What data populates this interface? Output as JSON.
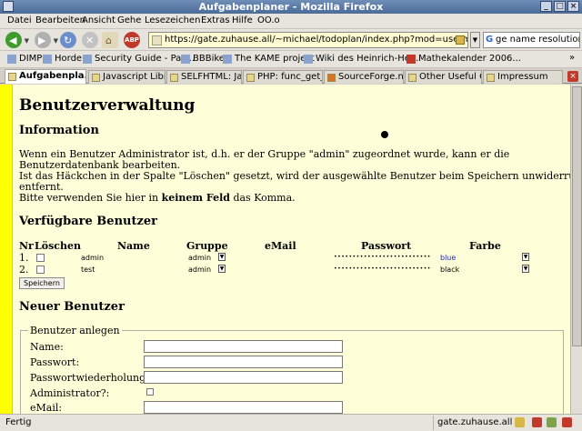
{
  "window": {
    "title": "Aufgabenplaner - Mozilla Firefox"
  },
  "menu": [
    "Datei",
    "Bearbeiten",
    "Ansicht",
    "Gehe",
    "Lesezeichen",
    "Extras",
    "Hilfe",
    "OO.o"
  ],
  "nav": {
    "url": "https://gate.zuhause.all/~michael/todoplan/index.php?mod=usermng",
    "search": "ge name resolution",
    "abp_label": "ABP"
  },
  "bookmarks": [
    "DIMP",
    "Horde",
    "Security Guide - Pas...",
    "BBBike",
    "The KAME project",
    "Wiki des Heinrich-He...",
    "Mathekalender 2006..."
  ],
  "tabs": [
    "Aufgabenpla...",
    "Javascript Libra...",
    "SELFHTML: Jav...",
    "PHP: func_get_...",
    "SourceForge.n...",
    "Other Useful C...",
    "Impressum"
  ],
  "page": {
    "title": "Benutzerverwaltung",
    "info_heading": "Information",
    "info_lines": [
      "Wenn ein Benutzer Administrator ist, d.h. er der Gruppe \"admin\" zugeordnet wurde, kann er die",
      "Benutzerdatenbank bearbeiten.",
      "Ist das Häckchen in der Spalte \"Löschen\" gesetzt, wird der ausgewählte Benutzer beim Speichern unwiderruflich",
      "entfernt."
    ],
    "comma_note": {
      "before": "Bitte verwenden Sie hier in ",
      "bold": "keinem Feld",
      "after": " das Komma."
    },
    "users_heading": "Verfügbare Benutzer",
    "columns": {
      "nr": "Nr",
      "delete": "Löschen",
      "name": "Name",
      "group": "Gruppe",
      "email": "eMail",
      "password": "Passwort",
      "color": "Farbe"
    },
    "users": [
      {
        "nr": "1.",
        "name": "admin",
        "group": "admin",
        "email": "",
        "password": "••••••••••••••••••••••••••",
        "color": "blue",
        "color_hex": "#2222cc"
      },
      {
        "nr": "2.",
        "name": "test",
        "group": "admin",
        "email": "",
        "password": "••••••••••••••••••••••••••",
        "color": "black",
        "color_hex": "#000000"
      }
    ],
    "save_label": "Speichern",
    "new_user_heading": "Neuer Benutzer",
    "new_user_legend": "Benutzer anlegen",
    "new_user_fields": [
      "Name:",
      "Passwort:",
      "Passwortwiederholung:",
      "Administrator?:",
      "eMail:"
    ]
  },
  "status": {
    "text": "Fertig",
    "host": "gate.zuhause.all"
  }
}
